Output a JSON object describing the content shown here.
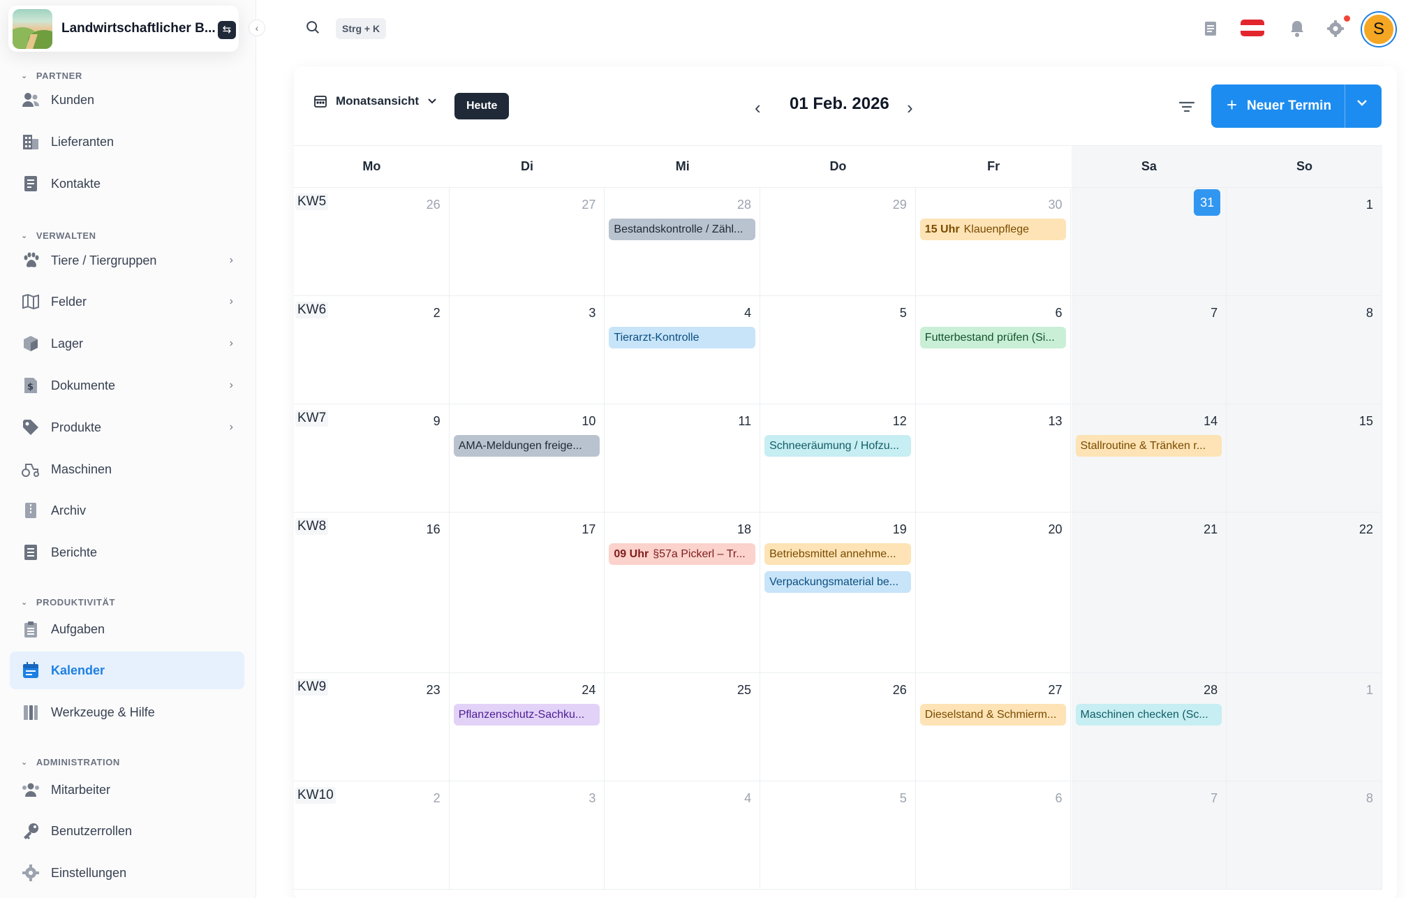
{
  "brand": {
    "name": "Landwirtschaftlicher B..."
  },
  "sidebar": {
    "sections": [
      {
        "title": "PARTNER",
        "items": [
          {
            "label": "Kunden",
            "icon": "customers-icon",
            "chevron": false
          },
          {
            "label": "Lieferanten",
            "icon": "building-icon",
            "chevron": false
          },
          {
            "label": "Kontakte",
            "icon": "contacts-icon",
            "chevron": false
          }
        ]
      },
      {
        "title": "VERWALTEN",
        "items": [
          {
            "label": "Tiere / Tiergruppen",
            "icon": "paw-icon",
            "chevron": true
          },
          {
            "label": "Felder",
            "icon": "map-icon",
            "chevron": true
          },
          {
            "label": "Lager",
            "icon": "box-icon",
            "chevron": true
          },
          {
            "label": "Dokumente",
            "icon": "dollar-document-icon",
            "chevron": true
          },
          {
            "label": "Produkte",
            "icon": "tag-icon",
            "chevron": true
          },
          {
            "label": "Maschinen",
            "icon": "tractor-icon",
            "chevron": false
          },
          {
            "label": "Archiv",
            "icon": "archive-icon",
            "chevron": false
          },
          {
            "label": "Berichte",
            "icon": "report-icon",
            "chevron": false
          }
        ]
      },
      {
        "title": "PRODUKTIVITÄT",
        "items": [
          {
            "label": "Aufgaben",
            "icon": "clipboard-icon",
            "chevron": false
          },
          {
            "label": "Kalender",
            "icon": "calendar-icon",
            "chevron": false,
            "active": true
          },
          {
            "label": "Werkzeuge & Hilfe",
            "icon": "tools-icon",
            "chevron": false
          }
        ]
      },
      {
        "title": "ADMINISTRATION",
        "items": [
          {
            "label": "Mitarbeiter",
            "icon": "team-icon",
            "chevron": false
          },
          {
            "label": "Benutzerrollen",
            "icon": "key-icon",
            "chevron": false
          },
          {
            "label": "Einstellungen",
            "icon": "gear-icon",
            "chevron": false
          }
        ]
      }
    ]
  },
  "topbar": {
    "shortcut": "Strg + K",
    "avatar_letter": "S"
  },
  "toolbar": {
    "view_label": "Monatsansicht",
    "today_label": "Heute",
    "date_title": "01 Feb. 2026",
    "new_label": "Neuer Termin"
  },
  "calendar": {
    "weekdays": [
      "Mo",
      "Di",
      "Mi",
      "Do",
      "Fr",
      "Sa",
      "So"
    ],
    "weeks": [
      {
        "kw": "KW5",
        "days": [
          {
            "d": "26",
            "out": true
          },
          {
            "d": "27",
            "out": true
          },
          {
            "d": "28",
            "out": true
          },
          {
            "d": "29",
            "out": true
          },
          {
            "d": "30",
            "out": true
          },
          {
            "d": "31",
            "today": true
          },
          {
            "d": "1"
          }
        ]
      },
      {
        "kw": "KW6",
        "days": [
          {
            "d": "2"
          },
          {
            "d": "3"
          },
          {
            "d": "4"
          },
          {
            "d": "5"
          },
          {
            "d": "6"
          },
          {
            "d": "7"
          },
          {
            "d": "8"
          }
        ]
      },
      {
        "kw": "KW7",
        "days": [
          {
            "d": "9"
          },
          {
            "d": "10"
          },
          {
            "d": "11"
          },
          {
            "d": "12"
          },
          {
            "d": "13"
          },
          {
            "d": "14"
          },
          {
            "d": "15"
          }
        ]
      },
      {
        "kw": "KW8",
        "days": [
          {
            "d": "16"
          },
          {
            "d": "17"
          },
          {
            "d": "18"
          },
          {
            "d": "19"
          },
          {
            "d": "20"
          },
          {
            "d": "21"
          },
          {
            "d": "22"
          }
        ]
      },
      {
        "kw": "KW9",
        "days": [
          {
            "d": "23"
          },
          {
            "d": "24"
          },
          {
            "d": "25"
          },
          {
            "d": "26"
          },
          {
            "d": "27"
          },
          {
            "d": "28"
          },
          {
            "d": "1",
            "out": true
          }
        ]
      },
      {
        "kw": "KW10",
        "days": [
          {
            "d": "2",
            "out": true
          },
          {
            "d": "3",
            "out": true
          },
          {
            "d": "4",
            "out": true
          },
          {
            "d": "5",
            "out": true
          },
          {
            "d": "6",
            "out": true
          },
          {
            "d": "7",
            "out": true
          },
          {
            "d": "8",
            "out": true
          }
        ]
      }
    ],
    "events": [
      {
        "week": 0,
        "day": 2,
        "slot": 0,
        "time": "",
        "title": "Bestandskontrolle / Zähl...",
        "bg": "#b9c3cf",
        "fg": "#1f2937"
      },
      {
        "week": 0,
        "day": 4,
        "slot": 0,
        "time": "15 Uhr",
        "title": "Klauenpflege",
        "bg": "#fde3b5",
        "fg": "#7a4b00"
      },
      {
        "week": 1,
        "day": 2,
        "slot": 0,
        "time": "",
        "title": "Tierarzt-Kontrolle",
        "bg": "#c8e4f9",
        "fg": "#0b4f80"
      },
      {
        "week": 1,
        "day": 4,
        "slot": 0,
        "time": "",
        "title": "Futterbestand prüfen (Si...",
        "bg": "#c9efd6",
        "fg": "#14532d"
      },
      {
        "week": 2,
        "day": 1,
        "slot": 0,
        "time": "",
        "title": "AMA-Meldungen freige...",
        "bg": "#b9c3cf",
        "fg": "#1f2937"
      },
      {
        "week": 2,
        "day": 3,
        "slot": 0,
        "time": "",
        "title": "Schneeräumung / Hofzu...",
        "bg": "#c7eef2",
        "fg": "#115e67"
      },
      {
        "week": 2,
        "day": 5,
        "slot": 0,
        "time": "",
        "title": "Stallroutine & Tränken r...",
        "bg": "#fde3b5",
        "fg": "#7a4b00"
      },
      {
        "week": 3,
        "day": 2,
        "slot": 0,
        "time": "09 Uhr",
        "title": "§57a Pickerl – Tr...",
        "bg": "#fbd2cc",
        "fg": "#7f1d1d"
      },
      {
        "week": 3,
        "day": 3,
        "slot": 0,
        "time": "",
        "title": "Betriebsmittel annehme...",
        "bg": "#fde3b5",
        "fg": "#7a4b00"
      },
      {
        "week": 3,
        "day": 3,
        "slot": 1,
        "time": "",
        "title": "Verpackungsmaterial be...",
        "bg": "#c8e4f9",
        "fg": "#0b4f80"
      },
      {
        "week": 4,
        "day": 1,
        "slot": 0,
        "time": "",
        "title": "Pflanzenschutz-Sachku...",
        "bg": "#e3d2f7",
        "fg": "#4c1d95"
      },
      {
        "week": 4,
        "day": 4,
        "slot": 0,
        "time": "",
        "title": "Dieselstand & Schmierm...",
        "bg": "#fde3b5",
        "fg": "#7a4b00"
      },
      {
        "week": 4,
        "day": 5,
        "slot": 0,
        "time": "",
        "title": "Maschinen checken (Sc...",
        "bg": "#c7eef2",
        "fg": "#115e67"
      }
    ]
  }
}
